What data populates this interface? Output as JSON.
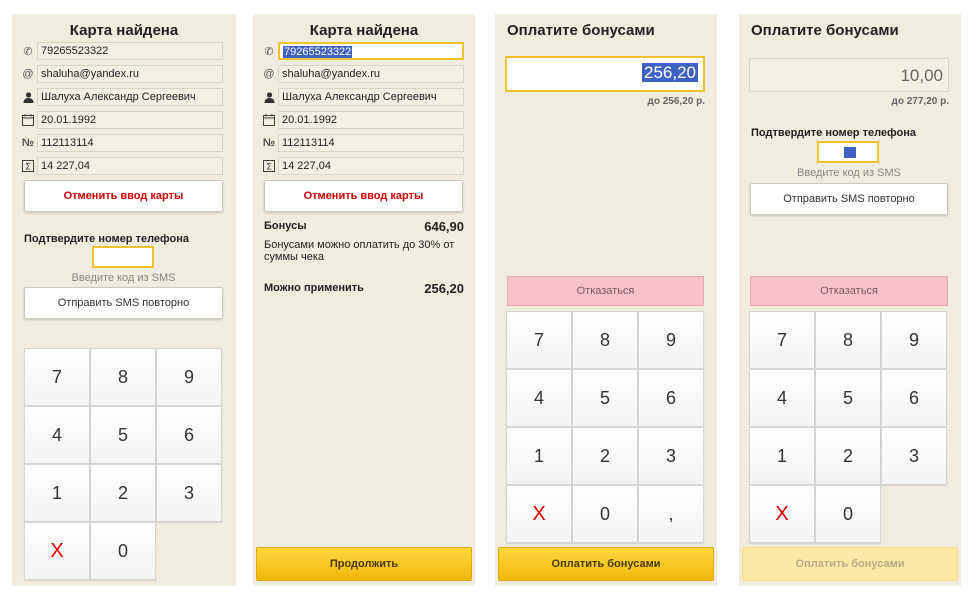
{
  "p1": {
    "title": "Карта найдена",
    "phone": "79265523322",
    "email": "shaluha@yandex.ru",
    "name": "Шалуха Александр Сергеевич",
    "birth": "20.01.1992",
    "number": "112113114",
    "sum": "14 227,04",
    "cancel": "Отменить ввод карты",
    "confirm": "Подтвердите номер телефона",
    "sms_hint": "Введите код из SMS",
    "resend": "Отправить SMS повторно",
    "keys": [
      "7",
      "8",
      "9",
      "4",
      "5",
      "6",
      "1",
      "2",
      "3",
      "X",
      "0"
    ]
  },
  "p2": {
    "title": "Карта найдена",
    "phone": "79265523322",
    "email": "shaluha@yandex.ru",
    "name": "Шалуха Александр Сергеевич",
    "birth": "20.01.1992",
    "number": "112113114",
    "sum": "14 227,04",
    "cancel": "Отменить ввод карты",
    "bonus_label": "Бонусы",
    "bonus_value": "646,90",
    "bonus_note": "Бонусами можно оплатить до 30% от суммы чека",
    "apply_label": "Можно применить",
    "apply_value": "256,20",
    "continue": "Продолжить"
  },
  "p3": {
    "title": "Оплатите бонусами",
    "amount": "256,20",
    "limit": "до 256,20 р.",
    "refuse": "Отказаться",
    "keys": [
      "7",
      "8",
      "9",
      "4",
      "5",
      "6",
      "1",
      "2",
      "3",
      "X",
      "0",
      ","
    ],
    "pay": "Оплатить бонусами"
  },
  "p4": {
    "title": "Оплатите бонусами",
    "amount": "10,00",
    "limit": "до 277,20 р.",
    "confirm": "Подтвердите номер телефона",
    "sms_hint": "Введите код из SMS",
    "resend": "Отправить SMS повторно",
    "refuse": "Отказаться",
    "keys": [
      "7",
      "8",
      "9",
      "4",
      "5",
      "6",
      "1",
      "2",
      "3",
      "X",
      "0"
    ],
    "pay": "Оплатить бонусами"
  },
  "icons": [
    "phone-icon",
    "at-icon",
    "person-icon",
    "calendar-icon",
    "number-icon",
    "sum-icon"
  ]
}
